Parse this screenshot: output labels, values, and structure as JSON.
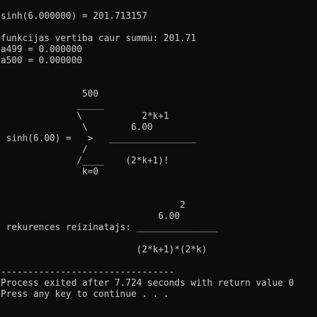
{
  "console": {
    "lines": [
      "sinh(6.000000) = 201.713157",
      "",
      "funkcijas vertiba caur summu: 201.71",
      "a499 = 0.000000",
      "a500 = 0.000000",
      "",
      "",
      "               500",
      "              _____",
      "              \\           2*k+1",
      "               \\        6.00",
      " sinh(6.00) =   >   ________________",
      "               /",
      "              /____    (2*k+1)!",
      "               k=0",
      "",
      "",
      "",
      "                                 2",
      "                             6.00",
      " rekurences reizinatajs: _______________",
      "",
      "                         (2*k+1)*(2*k)",
      "",
      "--------------------------------",
      "Process exited after 7.724 seconds with return value 0",
      "Press any key to continue . . ."
    ]
  }
}
